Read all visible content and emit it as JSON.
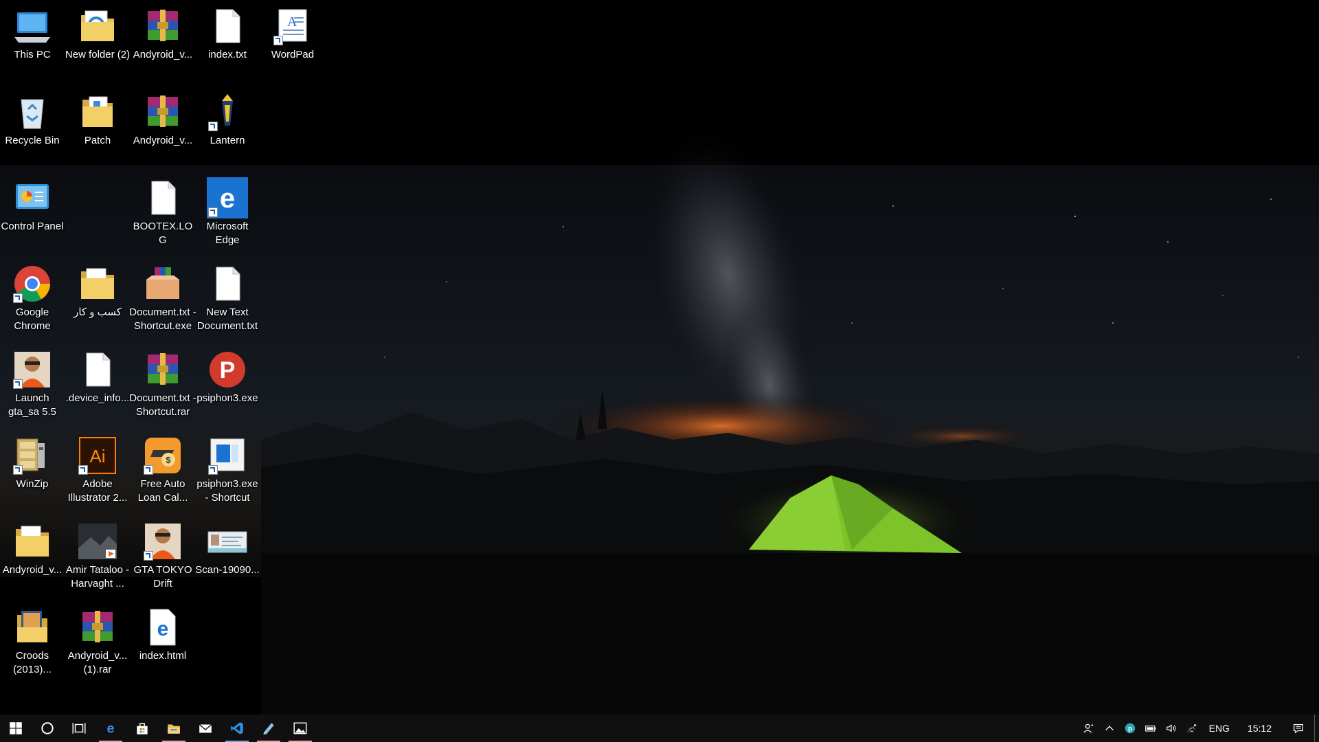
{
  "desktop": {
    "icons": [
      {
        "label": "This PC",
        "icon": "computer-icon",
        "shortcut": false
      },
      {
        "label": "New folder (2)",
        "icon": "folder-ie-icon",
        "shortcut": false
      },
      {
        "label": "Andyroid_v...",
        "icon": "winrar-archive-icon",
        "shortcut": false
      },
      {
        "label": "index.txt",
        "icon": "text-file-icon",
        "shortcut": false
      },
      {
        "label": "WordPad",
        "icon": "wordpad-icon",
        "shortcut": true
      },
      {
        "label": "Recycle Bin",
        "icon": "recycle-bin-icon",
        "shortcut": false
      },
      {
        "label": "Patch",
        "icon": "folder-doc-icon",
        "shortcut": false
      },
      {
        "label": "Andyroid_v...",
        "icon": "winrar-archive-icon",
        "shortcut": false
      },
      {
        "label": "Lantern",
        "icon": "lantern-icon",
        "shortcut": true
      },
      {
        "label": "Control Panel",
        "icon": "control-panel-icon",
        "shortcut": false
      },
      {
        "label": "BOOTEX.LOG",
        "icon": "text-file-icon",
        "shortcut": false
      },
      {
        "label": "Microsoft Edge",
        "icon": "edge-icon",
        "shortcut": true
      },
      {
        "label": "Google Chrome",
        "icon": "chrome-icon",
        "shortcut": true
      },
      {
        "label": "کسب و کار",
        "icon": "folder-icon",
        "shortcut": false
      },
      {
        "label": "Document.txt - Shortcut.exe",
        "icon": "installer-box-icon",
        "shortcut": false
      },
      {
        "label": "New Text Document.txt",
        "icon": "text-file-icon",
        "shortcut": false
      },
      {
        "label": "Launch gta_sa 5.5",
        "icon": "gta-character-icon",
        "shortcut": true
      },
      {
        "label": ".device_info...",
        "icon": "text-file-icon",
        "shortcut": false
      },
      {
        "label": "Document.txt - Shortcut.rar",
        "icon": "winrar-archive-icon",
        "shortcut": false
      },
      {
        "label": "psiphon3.exe",
        "icon": "psiphon-icon",
        "shortcut": false
      },
      {
        "label": "WinZip",
        "icon": "winzip-icon",
        "shortcut": true
      },
      {
        "label": "Adobe Illustrator 2...",
        "icon": "illustrator-icon",
        "shortcut": true
      },
      {
        "label": "Free Auto Loan Cal...",
        "icon": "loan-calc-icon",
        "shortcut": true
      },
      {
        "label": "psiphon3.exe - Shortcut",
        "icon": "window-app-icon",
        "shortcut": true
      },
      {
        "label": "Andyroid_v...",
        "icon": "folder-icon",
        "shortcut": false
      },
      {
        "label": "Amir Tataloo - Harvaght ...",
        "icon": "video-thumbnail-icon",
        "shortcut": false
      },
      {
        "label": "GTA TOKYO Drift",
        "icon": "gta-character-icon",
        "shortcut": true
      },
      {
        "label": "Scan-19090...",
        "icon": "scan-image-icon",
        "shortcut": false
      },
      {
        "label": "Croods (2013)...",
        "icon": "folder-movie-icon",
        "shortcut": false
      },
      {
        "label": "Andyroid_v... (1).rar",
        "icon": "winrar-archive-icon",
        "shortcut": false
      },
      {
        "label": "index.html",
        "icon": "edge-html-file-icon",
        "shortcut": false
      }
    ]
  },
  "taskbar": {
    "buttons": [
      {
        "icon": "windows-start-icon",
        "running": false
      },
      {
        "icon": "cortana-search-icon",
        "running": false
      },
      {
        "icon": "task-view-icon",
        "running": false
      },
      {
        "icon": "edge-icon",
        "running": true
      },
      {
        "icon": "store-icon",
        "running": false
      },
      {
        "icon": "file-explorer-icon",
        "running": true
      },
      {
        "icon": "mail-icon",
        "running": false
      },
      {
        "icon": "vscode-icon",
        "running": true
      },
      {
        "icon": "winzip-tray-icon",
        "running": true
      },
      {
        "icon": "photos-icon",
        "running": true
      }
    ],
    "tray": {
      "icons": [
        "people-icon",
        "chevron-up-icon",
        "psiphon-tray-icon",
        "battery-icon",
        "volume-icon",
        "wifi-icon"
      ],
      "language": "ENG",
      "clock": "15:12",
      "notification_icon": "action-center-icon"
    }
  },
  "colors": {
    "taskbar_bg": "#101010",
    "tent_green": "#7dc42a",
    "horizon_glow": "#d9661e"
  }
}
